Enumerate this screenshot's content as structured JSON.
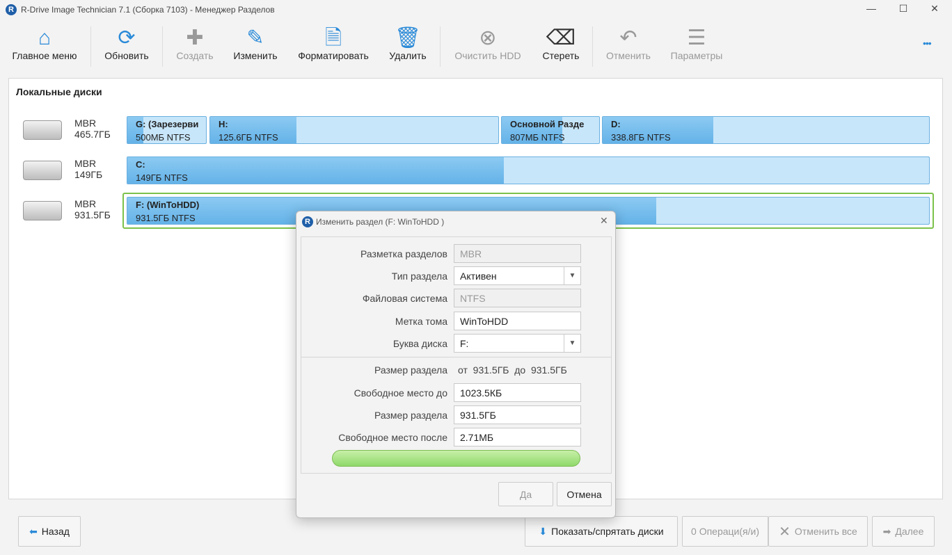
{
  "window": {
    "title": "R-Drive Image Technician 7.1 (Сборка 7103) - Менеджер Разделов",
    "minimize": "—",
    "maximize": "☐",
    "close": "✕"
  },
  "toolbar": {
    "items": [
      {
        "label": "Главное меню",
        "icon": "home-icon",
        "enabled": true
      },
      {
        "label": "Обновить",
        "icon": "refresh-icon",
        "enabled": true
      },
      {
        "label": "Создать",
        "icon": "plus-icon",
        "enabled": false
      },
      {
        "label": "Изменить",
        "icon": "pencil-icon",
        "enabled": true
      },
      {
        "label": "Форматировать",
        "icon": "format-fs-icon",
        "enabled": true
      },
      {
        "label": "Удалить",
        "icon": "trash-icon",
        "enabled": true
      },
      {
        "label": "Очистить HDD",
        "icon": "wipe-hdd-icon",
        "enabled": false
      },
      {
        "label": "Стереть",
        "icon": "eraser-icon",
        "enabled": true
      },
      {
        "label": "Отменить",
        "icon": "undo-icon",
        "enabled": false
      },
      {
        "label": "Параметры",
        "icon": "menu-icon",
        "enabled": false
      }
    ],
    "more": "•••"
  },
  "main": {
    "title": "Локальные диски",
    "disks": [
      {
        "scheme": "MBR",
        "size": "465.7ГБ",
        "partitions": [
          {
            "name": "G: (Зарезерви",
            "size": "500МБ NTFS",
            "used": 0.2
          },
          {
            "name": "H:",
            "size": "125.6ГБ NTFS",
            "used": 0.3
          },
          {
            "name": "Основной Разде",
            "size": "807МБ NTFS",
            "used": 0.62
          },
          {
            "name": "D:",
            "size": "338.8ГБ NTFS",
            "used": 0.34
          }
        ]
      },
      {
        "scheme": "MBR",
        "size": "149ГБ",
        "partitions": [
          {
            "name": "C:",
            "size": "149ГБ NTFS",
            "used": 0.47
          }
        ]
      },
      {
        "scheme": "MBR",
        "size": "931.5ГБ",
        "partitions": [
          {
            "name": "F: (WinToHDD)",
            "size": "931.5ГБ NTFS",
            "used": 0.66
          }
        ]
      }
    ]
  },
  "dialog": {
    "title": "Изменить раздел (F: WinToHDD )",
    "close": "✕",
    "fields": {
      "scheme_label": "Разметка разделов",
      "scheme": "MBR",
      "type_label": "Тип раздела",
      "type": "Активен",
      "fs_label": "Файловая система",
      "fs": "NTFS",
      "volume_label": "Метка тома",
      "volume": "WinToHDD",
      "letter_label": "Буква диска",
      "letter": "F:",
      "range_label": "Размер раздела",
      "range": "от  931.5ГБ  до  931.5ГБ",
      "free_before_label": "Свободное место до",
      "free_before": "1023.5КБ",
      "size_label": "Размер раздела",
      "size": "931.5ГБ",
      "free_after_label": "Свободное место после",
      "free_after": "2.71МБ"
    },
    "ok": "Да",
    "cancel": "Отмена",
    "accent": "#8fd86a"
  },
  "bottom": {
    "back": "Назад",
    "toggle": "Показать/спрятать диски",
    "ops": "0 Операци(я/и)",
    "cancel_all": "Отменить все",
    "next": "Далее"
  }
}
